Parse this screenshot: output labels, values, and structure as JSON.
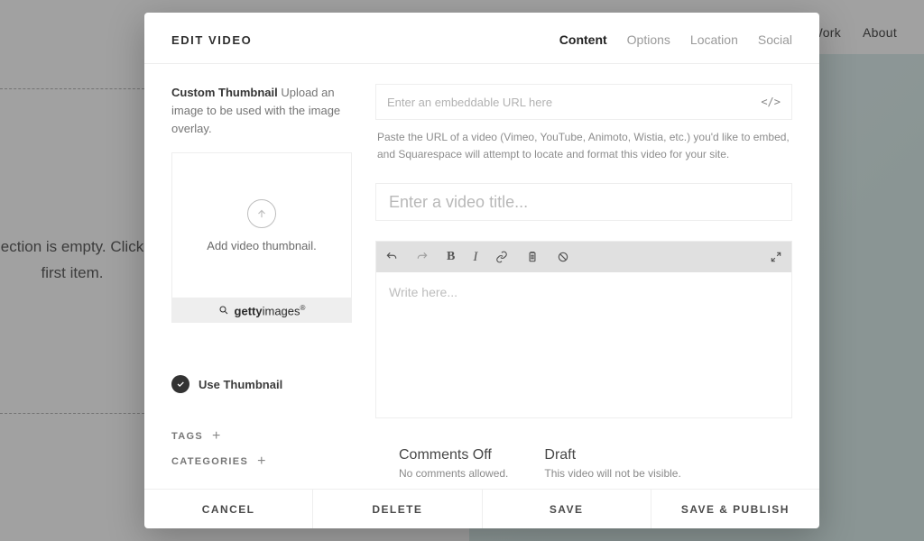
{
  "background": {
    "nav": {
      "work": "Work",
      "about": "About"
    },
    "empty_line1": "ection is empty. Click",
    "empty_line2": "first item."
  },
  "modal": {
    "title": "EDIT VIDEO",
    "tabs": {
      "content": "Content",
      "options": "Options",
      "location": "Location",
      "social": "Social"
    }
  },
  "left": {
    "thumb_label_strong": "Custom Thumbnail",
    "thumb_label_rest": " Upload an image to be used with the image overlay.",
    "add_thumb": "Add video thumbnail.",
    "getty": "gettyimages",
    "use_thumb": "Use Thumbnail",
    "tags": "TAGS",
    "categories": "CATEGORIES"
  },
  "right": {
    "url_placeholder": "Enter an embeddable URL here",
    "helper": "Paste the URL of a video (Vimeo, YouTube, Animoto, Wistia, etc.) you'd like to embed, and Squarespace will attempt to locate and format this video for your site.",
    "title_placeholder": "Enter a video title...",
    "body_placeholder": "Write here...",
    "status": {
      "comments_h": "Comments Off",
      "comments_p": "No comments allowed.",
      "draft_h": "Draft",
      "draft_p": "This video will not be visible."
    }
  },
  "footer": {
    "cancel": "CANCEL",
    "delete": "DELETE",
    "save": "SAVE",
    "publish": "SAVE & PUBLISH"
  }
}
